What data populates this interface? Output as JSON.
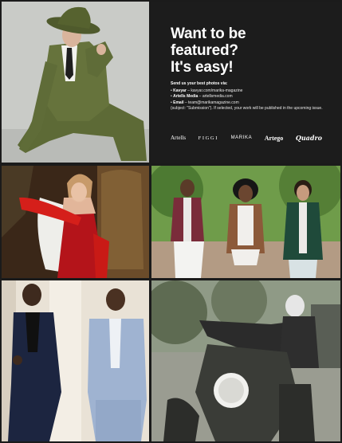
{
  "info": {
    "title_lines": [
      "Want to be",
      "featured?",
      "It's easy!"
    ],
    "lead": "Send us your best photos via:",
    "items": [
      {
        "name": "Kavyar",
        "detail": " – kavyar.com/marika-magazine"
      },
      {
        "name": "Artells Media",
        "detail": " – artellsmedia.com"
      },
      {
        "name": "Email",
        "detail": " – team@marikamagazine.com"
      }
    ],
    "note": "(subject: \"Submission\"). If selected, your work will be published in the upcoming issue.",
    "brands": [
      "Artells",
      "FIGGI",
      "MARIKA",
      "Artego",
      "Quadro"
    ]
  },
  "photos": {
    "green_suit": "photo-man-green-suit",
    "red_dress": "photo-woman-red-dress",
    "trio": "photo-three-models-outdoors",
    "suits": "photo-two-men-suits",
    "motorcycle": "photo-woman-motorcycle"
  },
  "colors": {
    "panel_bg": "#1c1c1c",
    "text": "#ffffff",
    "gutter": "#1b1b1b"
  }
}
